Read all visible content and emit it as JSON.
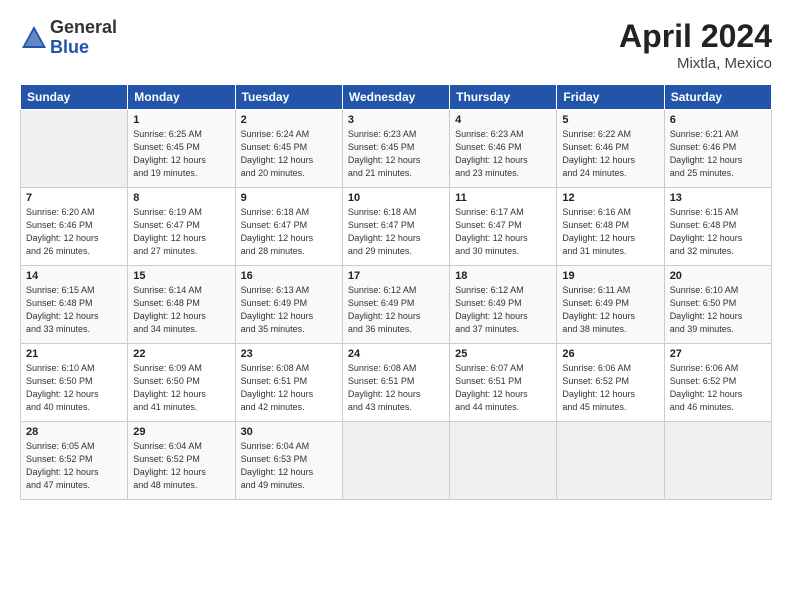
{
  "header": {
    "logo_general": "General",
    "logo_blue": "Blue",
    "month_year": "April 2024",
    "location": "Mixtla, Mexico"
  },
  "days_of_week": [
    "Sunday",
    "Monday",
    "Tuesday",
    "Wednesday",
    "Thursday",
    "Friday",
    "Saturday"
  ],
  "weeks": [
    [
      {
        "day": "",
        "info": ""
      },
      {
        "day": "1",
        "info": "Sunrise: 6:25 AM\nSunset: 6:45 PM\nDaylight: 12 hours\nand 19 minutes."
      },
      {
        "day": "2",
        "info": "Sunrise: 6:24 AM\nSunset: 6:45 PM\nDaylight: 12 hours\nand 20 minutes."
      },
      {
        "day": "3",
        "info": "Sunrise: 6:23 AM\nSunset: 6:45 PM\nDaylight: 12 hours\nand 21 minutes."
      },
      {
        "day": "4",
        "info": "Sunrise: 6:23 AM\nSunset: 6:46 PM\nDaylight: 12 hours\nand 23 minutes."
      },
      {
        "day": "5",
        "info": "Sunrise: 6:22 AM\nSunset: 6:46 PM\nDaylight: 12 hours\nand 24 minutes."
      },
      {
        "day": "6",
        "info": "Sunrise: 6:21 AM\nSunset: 6:46 PM\nDaylight: 12 hours\nand 25 minutes."
      }
    ],
    [
      {
        "day": "7",
        "info": "Sunrise: 6:20 AM\nSunset: 6:46 PM\nDaylight: 12 hours\nand 26 minutes."
      },
      {
        "day": "8",
        "info": "Sunrise: 6:19 AM\nSunset: 6:47 PM\nDaylight: 12 hours\nand 27 minutes."
      },
      {
        "day": "9",
        "info": "Sunrise: 6:18 AM\nSunset: 6:47 PM\nDaylight: 12 hours\nand 28 minutes."
      },
      {
        "day": "10",
        "info": "Sunrise: 6:18 AM\nSunset: 6:47 PM\nDaylight: 12 hours\nand 29 minutes."
      },
      {
        "day": "11",
        "info": "Sunrise: 6:17 AM\nSunset: 6:47 PM\nDaylight: 12 hours\nand 30 minutes."
      },
      {
        "day": "12",
        "info": "Sunrise: 6:16 AM\nSunset: 6:48 PM\nDaylight: 12 hours\nand 31 minutes."
      },
      {
        "day": "13",
        "info": "Sunrise: 6:15 AM\nSunset: 6:48 PM\nDaylight: 12 hours\nand 32 minutes."
      }
    ],
    [
      {
        "day": "14",
        "info": "Sunrise: 6:15 AM\nSunset: 6:48 PM\nDaylight: 12 hours\nand 33 minutes."
      },
      {
        "day": "15",
        "info": "Sunrise: 6:14 AM\nSunset: 6:48 PM\nDaylight: 12 hours\nand 34 minutes."
      },
      {
        "day": "16",
        "info": "Sunrise: 6:13 AM\nSunset: 6:49 PM\nDaylight: 12 hours\nand 35 minutes."
      },
      {
        "day": "17",
        "info": "Sunrise: 6:12 AM\nSunset: 6:49 PM\nDaylight: 12 hours\nand 36 minutes."
      },
      {
        "day": "18",
        "info": "Sunrise: 6:12 AM\nSunset: 6:49 PM\nDaylight: 12 hours\nand 37 minutes."
      },
      {
        "day": "19",
        "info": "Sunrise: 6:11 AM\nSunset: 6:49 PM\nDaylight: 12 hours\nand 38 minutes."
      },
      {
        "day": "20",
        "info": "Sunrise: 6:10 AM\nSunset: 6:50 PM\nDaylight: 12 hours\nand 39 minutes."
      }
    ],
    [
      {
        "day": "21",
        "info": "Sunrise: 6:10 AM\nSunset: 6:50 PM\nDaylight: 12 hours\nand 40 minutes."
      },
      {
        "day": "22",
        "info": "Sunrise: 6:09 AM\nSunset: 6:50 PM\nDaylight: 12 hours\nand 41 minutes."
      },
      {
        "day": "23",
        "info": "Sunrise: 6:08 AM\nSunset: 6:51 PM\nDaylight: 12 hours\nand 42 minutes."
      },
      {
        "day": "24",
        "info": "Sunrise: 6:08 AM\nSunset: 6:51 PM\nDaylight: 12 hours\nand 43 minutes."
      },
      {
        "day": "25",
        "info": "Sunrise: 6:07 AM\nSunset: 6:51 PM\nDaylight: 12 hours\nand 44 minutes."
      },
      {
        "day": "26",
        "info": "Sunrise: 6:06 AM\nSunset: 6:52 PM\nDaylight: 12 hours\nand 45 minutes."
      },
      {
        "day": "27",
        "info": "Sunrise: 6:06 AM\nSunset: 6:52 PM\nDaylight: 12 hours\nand 46 minutes."
      }
    ],
    [
      {
        "day": "28",
        "info": "Sunrise: 6:05 AM\nSunset: 6:52 PM\nDaylight: 12 hours\nand 47 minutes."
      },
      {
        "day": "29",
        "info": "Sunrise: 6:04 AM\nSunset: 6:52 PM\nDaylight: 12 hours\nand 48 minutes."
      },
      {
        "day": "30",
        "info": "Sunrise: 6:04 AM\nSunset: 6:53 PM\nDaylight: 12 hours\nand 49 minutes."
      },
      {
        "day": "",
        "info": ""
      },
      {
        "day": "",
        "info": ""
      },
      {
        "day": "",
        "info": ""
      },
      {
        "day": "",
        "info": ""
      }
    ]
  ]
}
